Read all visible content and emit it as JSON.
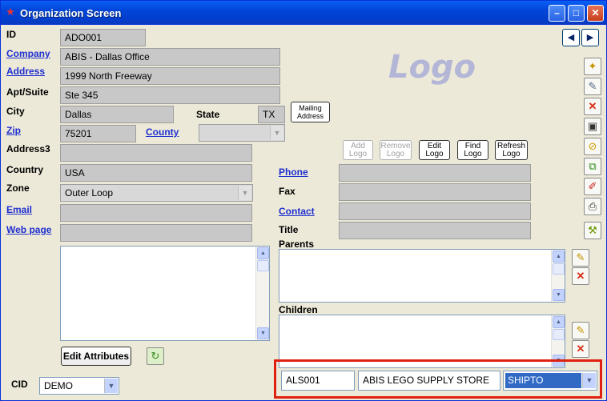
{
  "window": {
    "title": "Organization Screen",
    "minimize_label": "–",
    "maximize_label": "□",
    "close_label": "✕"
  },
  "nav": {
    "prev_label": "◀",
    "next_label": "▶"
  },
  "labels": {
    "id": "ID",
    "company": "Company",
    "address": "Address",
    "apt_suite": "Apt/Suite",
    "city": "City",
    "state": "State",
    "zip": "Zip",
    "county": "County",
    "address3": "Address3",
    "country": "Country",
    "zone": "Zone",
    "email": "Email",
    "web_page": "Web page",
    "phone": "Phone",
    "fax": "Fax",
    "contact": "Contact",
    "title": "Title",
    "parents": "Parents",
    "children": "Children",
    "cid": "CID"
  },
  "values": {
    "id": "ADO001",
    "company": "ABIS - Dallas Office",
    "address": "1999 North Freeway",
    "apt_suite": "Ste 345",
    "city": "Dallas",
    "state": "TX",
    "zip": "75201",
    "county": "",
    "address3": "",
    "country": "USA",
    "zone": "Outer Loop",
    "email": "",
    "web_page": "",
    "phone": "",
    "fax": "",
    "contact": "",
    "title": "",
    "cid": "DEMO"
  },
  "logo_placeholder": "Logo",
  "buttons": {
    "mailing_address": "Mailing Address",
    "add_logo": "Add Logo",
    "remove_logo": "Remove Logo",
    "edit_logo": "Edit Logo",
    "find_logo": "Find Logo",
    "refresh_logo": "Refresh Logo",
    "edit_attributes": "Edit Attributes"
  },
  "footer": {
    "code": "ALS001",
    "name": "ABIS LEGO SUPPLY STORE",
    "type": "SHIPTO"
  },
  "colors": {
    "title_bar": "#0A5FF5",
    "link": "#1F2FD0",
    "highlight_box": "#E02010",
    "selected": "#316AC5"
  }
}
